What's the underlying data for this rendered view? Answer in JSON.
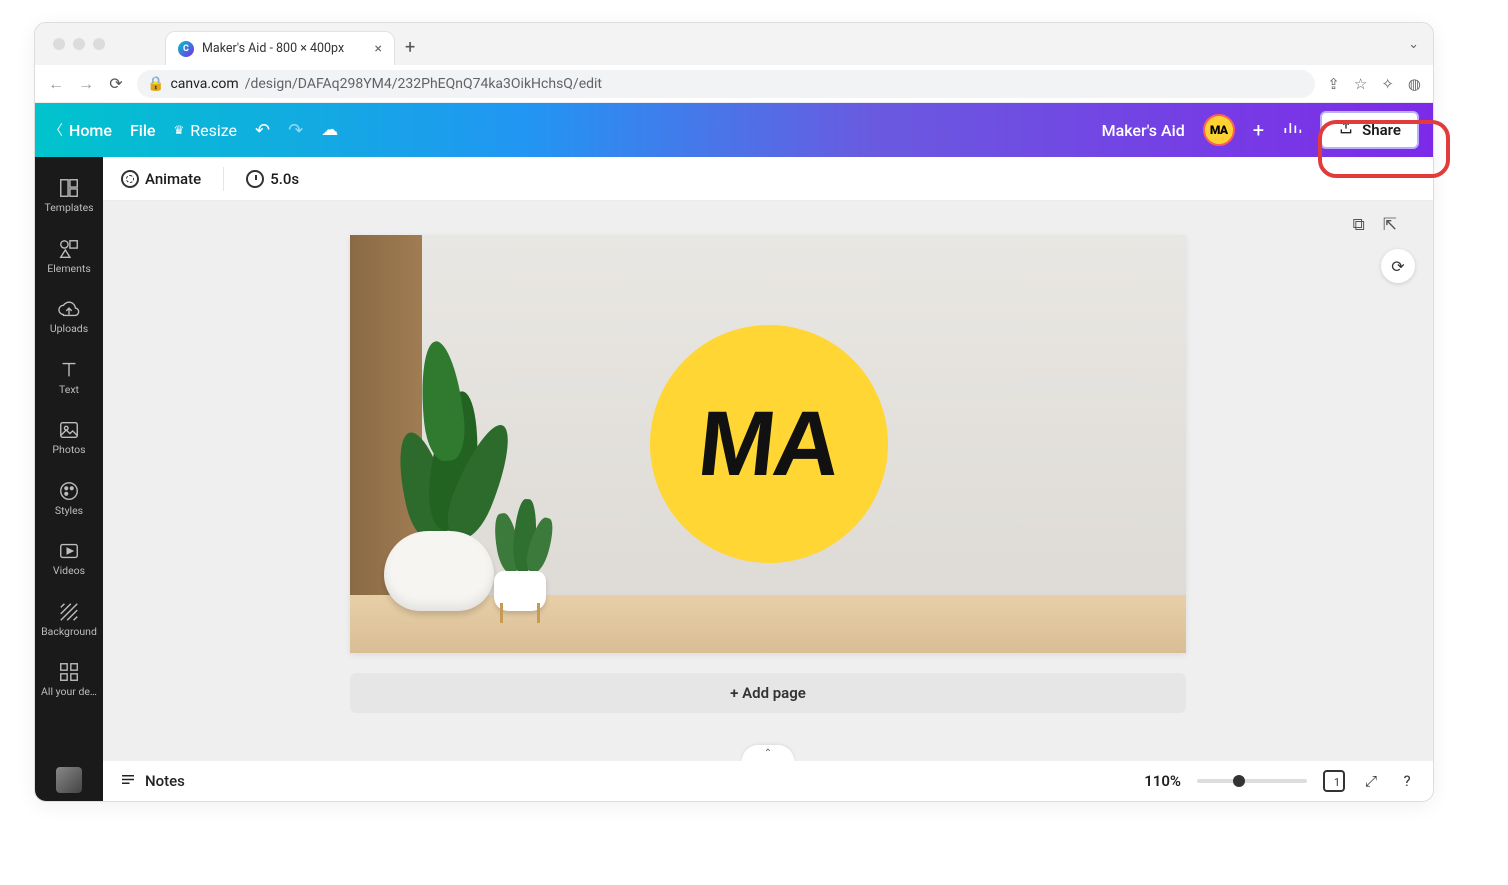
{
  "browser": {
    "tab_title": "Maker's Aid - 800 × 400px",
    "url_domain": "canva.com",
    "url_path": "/design/DAFAq298YM4/232PhEQnQ74ka3OikHchsQ/edit"
  },
  "top_bar": {
    "home": "Home",
    "file": "File",
    "resize": "Resize",
    "doc_title": "Maker's Aid",
    "avatar_text": "MA",
    "share_label": "Share"
  },
  "secondary_bar": {
    "animate": "Animate",
    "duration": "5.0s"
  },
  "sidebar": {
    "items": [
      {
        "label": "Templates",
        "icon": "templates-icon"
      },
      {
        "label": "Elements",
        "icon": "elements-icon"
      },
      {
        "label": "Uploads",
        "icon": "uploads-icon"
      },
      {
        "label": "Text",
        "icon": "text-icon"
      },
      {
        "label": "Photos",
        "icon": "photos-icon"
      },
      {
        "label": "Styles",
        "icon": "styles-icon"
      },
      {
        "label": "Videos",
        "icon": "videos-icon"
      },
      {
        "label": "Background",
        "icon": "background-icon"
      },
      {
        "label": "All your de…",
        "icon": "designs-icon"
      }
    ]
  },
  "canvas": {
    "logo_text": "MA",
    "add_page": "+ Add page"
  },
  "bottom": {
    "notes": "Notes",
    "zoom": "110%",
    "page_count": "1"
  },
  "annotation": {
    "highlight_target": "share-button"
  }
}
